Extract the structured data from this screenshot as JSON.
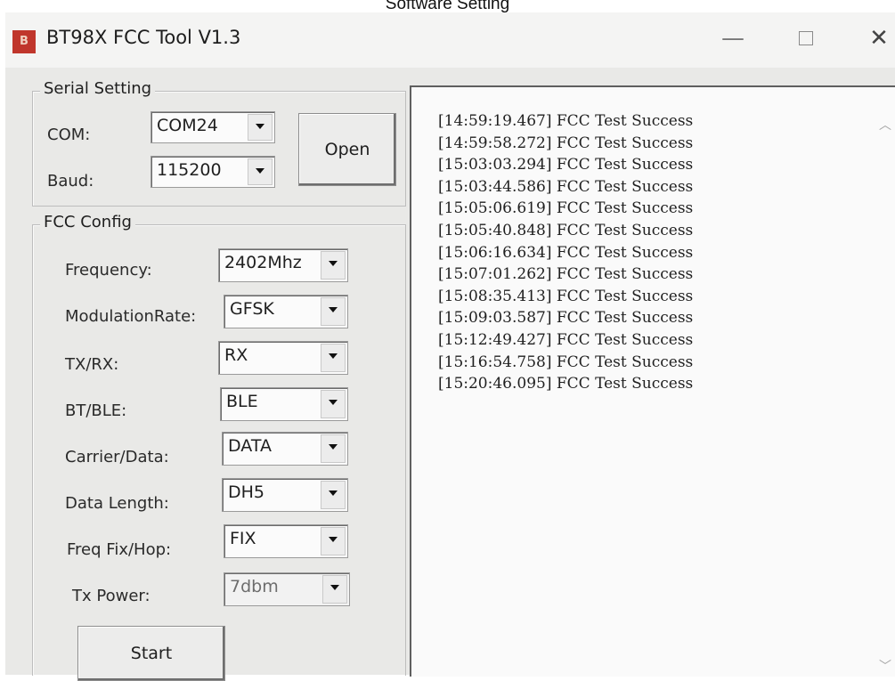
{
  "caption": "Software Setting",
  "window": {
    "title": "BT98X FCC Tool V1.3",
    "icon": "app-icon"
  },
  "serial": {
    "group_title": "Serial Setting",
    "com_label": "COM:",
    "com_value": "COM24",
    "baud_label": "Baud:",
    "baud_value": "115200",
    "open_label": "Open"
  },
  "fcc": {
    "group_title": "FCC Config",
    "frequency_label": "Frequency:",
    "frequency_value": "2402Mhz",
    "modulation_label": "ModulationRate:",
    "modulation_value": "GFSK",
    "txrx_label": "TX/RX:",
    "txrx_value": "RX",
    "btble_label": "BT/BLE:",
    "btble_value": "BLE",
    "carrier_label": "Carrier/Data:",
    "carrier_value": "DATA",
    "datalen_label": "Data Length:",
    "datalen_value": "DH5",
    "freqfix_label": "Freq Fix/Hop:",
    "freqfix_value": "FIX",
    "txpower_label": "Tx Power:",
    "txpower_value": "7dbm",
    "start_label": "Start"
  },
  "log": [
    "[14:59:19.467] FCC Test Success",
    "[14:59:58.272] FCC Test Success",
    "[15:03:03.294] FCC Test Success",
    "[15:03:44.586] FCC Test Success",
    "[15:05:06.619] FCC Test Success",
    "[15:05:40.848] FCC Test Success",
    "[15:06:16.634] FCC Test Success",
    "[15:07:01.262] FCC Test Success",
    "[15:08:35.413] FCC Test Success",
    "[15:09:03.587] FCC Test Success",
    "[15:12:49.427] FCC Test Success",
    "[15:16:54.758] FCC Test Success",
    "[15:20:46.095] FCC Test Success"
  ]
}
